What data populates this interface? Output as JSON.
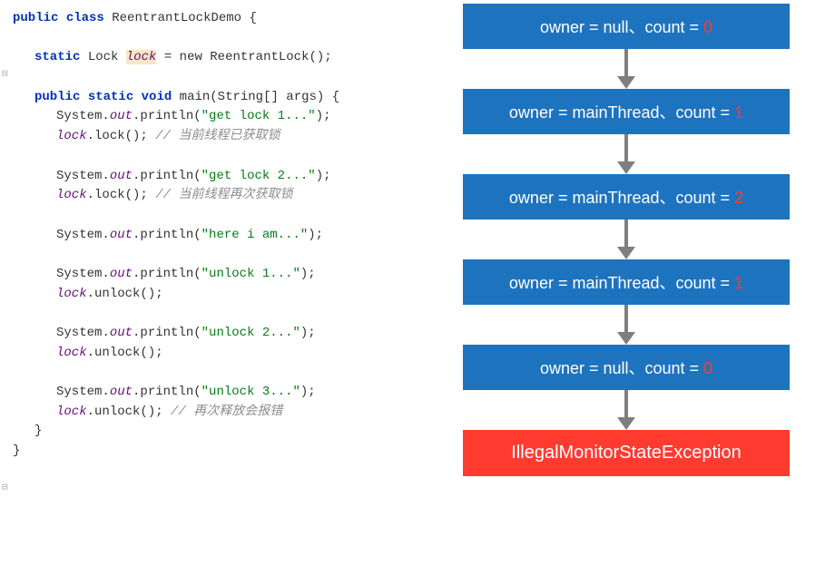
{
  "code": {
    "kw_public": "public",
    "kw_class": "class",
    "class_name": "ReentrantLockDemo",
    "open_brace": "{",
    "kw_static": "static",
    "type_lock": "Lock",
    "var_lock": "lock",
    "assign_new": "= new ReentrantLock();",
    "kw_void": "void",
    "method_main": "main(String[] args) {",
    "sys_out": "System.",
    "out_field": "out",
    "println": ".println(",
    "str_get1": "\"get lock 1...\"",
    "close_paren": ");",
    "lock_call": ".lock();",
    "cmt_acquired": "// 当前线程已获取锁",
    "str_get2": "\"get lock 2...\"",
    "cmt_reacquire": "// 当前线程再次获取锁",
    "str_here": "\"here i am...\"",
    "str_unlock1": "\"unlock 1...\"",
    "unlock_call": ".unlock();",
    "str_unlock2": "\"unlock 2...\"",
    "str_unlock3": "\"unlock 3...\"",
    "cmt_error": "// 再次释放会报错",
    "close_brace": "}"
  },
  "diagram": {
    "states": [
      {
        "owner": "null",
        "count": "0",
        "zero": true
      },
      {
        "owner": "mainThread",
        "count": "1",
        "zero": false
      },
      {
        "owner": "mainThread",
        "count": "2",
        "zero": false
      },
      {
        "owner": "mainThread",
        "count": "1",
        "zero": false
      },
      {
        "owner": "null",
        "count": "0",
        "zero": true
      }
    ],
    "label_owner": "owner = ",
    "label_sep": "、",
    "label_count": "count = ",
    "exception": "IllegalMonitorStateException"
  }
}
